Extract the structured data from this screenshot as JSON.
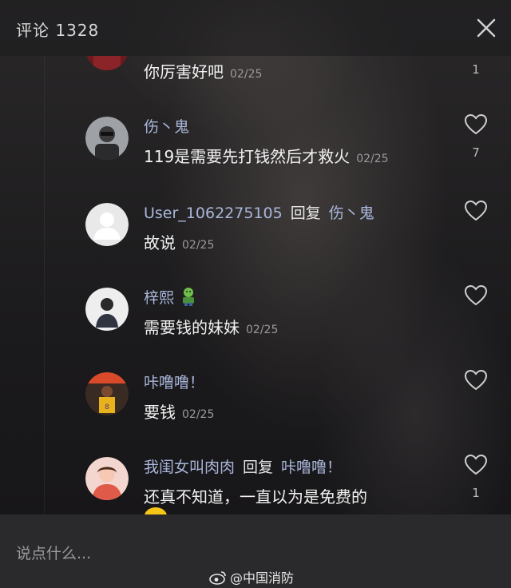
{
  "header": {
    "title": "评论 1328"
  },
  "comments": [
    {
      "user": "",
      "reply_label": "",
      "reply_to": "",
      "text": "你厉害好吧",
      "date": "02/25",
      "likes": "1"
    },
    {
      "user": "伤丶鬼",
      "reply_label": "",
      "reply_to": "",
      "text": "119是需要先打钱然后才救火",
      "date": "02/25",
      "likes": "7"
    },
    {
      "user": "User_1062275105",
      "reply_label": "回复",
      "reply_to": "伤丶鬼",
      "text": "故说",
      "date": "02/25",
      "likes": ""
    },
    {
      "user": "梓熙",
      "reply_label": "",
      "reply_to": "",
      "text": "需要钱的妹妹",
      "date": "02/25",
      "likes": ""
    },
    {
      "user": "咔噜噜！",
      "reply_label": "",
      "reply_to": "",
      "text": "要钱",
      "date": "02/25",
      "likes": ""
    },
    {
      "user": "我闺女叫肉肉",
      "reply_label": "回复",
      "reply_to": "咔噜噜！",
      "text": "还真不知道，一直以为是免费的",
      "date": "",
      "likes": "1"
    }
  ],
  "input": {
    "placeholder": "说点什么..."
  },
  "watermark": {
    "text": "@中国消防"
  },
  "icons": {
    "close": "close-icon",
    "like": "heart-outline-icon",
    "zombie_emoji": "zombie-emoji-icon",
    "weibo": "weibo-logo-icon"
  },
  "colors": {
    "username": "#a9b6da",
    "background": "#1c1b1d",
    "input_bar": "#2a292b"
  }
}
